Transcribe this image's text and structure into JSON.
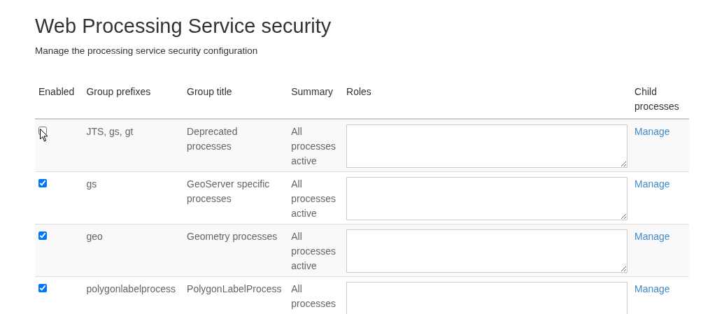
{
  "page": {
    "title": "Web Processing Service security",
    "subtitle": "Manage the processing service security configuration"
  },
  "table": {
    "columns": [
      "Enabled",
      "Group prefixes",
      "Group title",
      "Summary",
      "Roles",
      "Child processes"
    ],
    "rows": [
      {
        "enabled": false,
        "prefixes": "JTS, gs, gt",
        "title": "Deprecated processes",
        "summary": "All processes active",
        "roles": "",
        "link": "Manage"
      },
      {
        "enabled": true,
        "prefixes": "gs",
        "title": "GeoServer specific processes",
        "summary": "All processes active",
        "roles": "",
        "link": "Manage"
      },
      {
        "enabled": true,
        "prefixes": "geo",
        "title": "Geometry processes",
        "summary": "All processes active",
        "roles": "",
        "link": "Manage"
      },
      {
        "enabled": true,
        "prefixes": "polygonlabelprocess",
        "title": "PolygonLabelProcess",
        "summary": "All processes",
        "roles": "",
        "link": "Manage"
      }
    ]
  }
}
